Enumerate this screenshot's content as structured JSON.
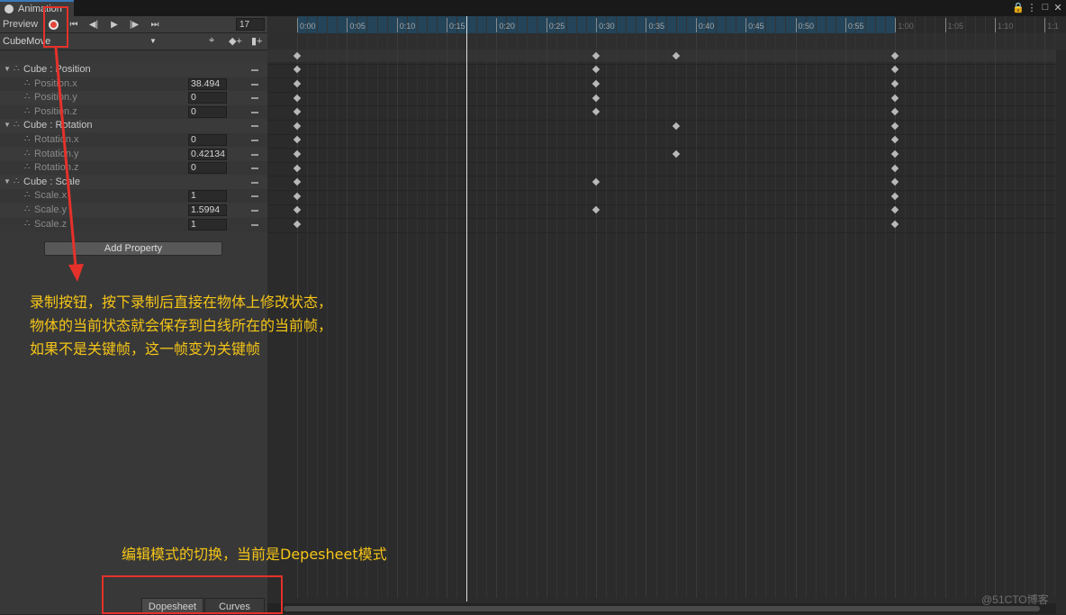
{
  "window": {
    "tab_title": "Animation"
  },
  "toolbar": {
    "preview_label": "Preview",
    "frame_value": "17",
    "icons": [
      "record-icon",
      "first-key-icon",
      "prev-key-icon",
      "play-icon",
      "next-key-icon",
      "last-key-icon"
    ]
  },
  "clip": {
    "selected": "CubeMove"
  },
  "properties": [
    {
      "label": "Cube : Position",
      "type": "group"
    },
    {
      "label": "Position.x",
      "type": "prop",
      "value": "38.494"
    },
    {
      "label": "Position.y",
      "type": "prop",
      "value": "0"
    },
    {
      "label": "Position.z",
      "type": "prop",
      "value": "0"
    },
    {
      "label": "Cube : Rotation",
      "type": "group"
    },
    {
      "label": "Rotation.x",
      "type": "prop",
      "value": "0"
    },
    {
      "label": "Rotation.y",
      "type": "prop",
      "value": "0.42134"
    },
    {
      "label": "Rotation.z",
      "type": "prop",
      "value": "0"
    },
    {
      "label": "Cube : Scale",
      "type": "group"
    },
    {
      "label": "Scale.x",
      "type": "prop",
      "value": "1"
    },
    {
      "label": "Scale.y",
      "type": "prop",
      "value": "1.5994"
    },
    {
      "label": "Scale.z",
      "type": "prop",
      "value": "1"
    }
  ],
  "add_property_label": "Add Property",
  "modes": {
    "dopesheet": "Dopesheet",
    "curves": "Curves"
  },
  "timeline": {
    "ticks": [
      "0:00",
      "0:05",
      "0:10",
      "0:15",
      "0:20",
      "0:25",
      "0:30",
      "0:35",
      "0:40",
      "0:45",
      "0:50",
      "0:55",
      "1:00",
      "1:05",
      "1:10",
      "1:1"
    ],
    "current_frame": 17,
    "clip_end": "1:00",
    "keyframes_by_row": [
      [
        "0:00",
        "0:30",
        "0:38",
        "1:00"
      ],
      [
        "0:00",
        "0:30",
        "1:00"
      ],
      [
        "0:00",
        "0:30",
        "1:00"
      ],
      [
        "0:00",
        "0:30",
        "1:00"
      ],
      [
        "0:00",
        "0:30",
        "1:00"
      ],
      [
        "0:00",
        "0:38",
        "1:00"
      ],
      [
        "0:00",
        "1:00"
      ],
      [
        "0:00",
        "0:38",
        "1:00"
      ],
      [
        "0:00",
        "1:00"
      ],
      [
        "0:00",
        "0:30",
        "1:00"
      ],
      [
        "0:00",
        "1:00"
      ],
      [
        "0:00",
        "0:30",
        "1:00"
      ],
      [
        "0:00",
        "1:00"
      ]
    ]
  },
  "annotations": {
    "record_note": [
      "录制按钮，按下录制后直接在物体上修改状态，",
      "物体的当前状态就会保存到白线所在的当前帧，",
      "如果不是关键帧，这一帧变为关键帧"
    ],
    "mode_note": "编辑模式的切换，当前是Depesheet模式"
  },
  "watermark": "@51CTO博客"
}
